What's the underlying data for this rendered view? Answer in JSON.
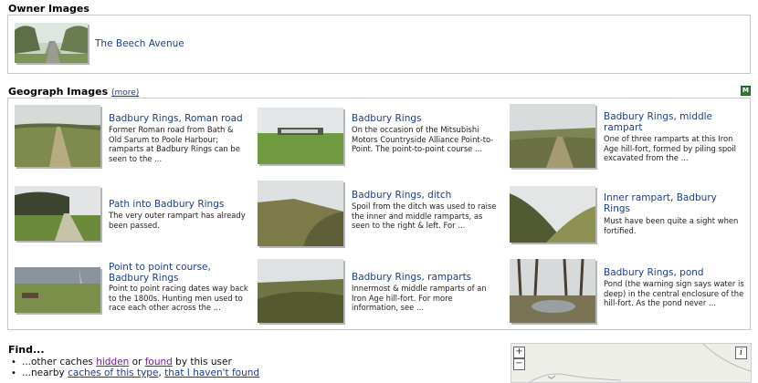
{
  "owner_images": {
    "heading": "Owner Images",
    "items": [
      {
        "title": "The Beech Avenue"
      }
    ]
  },
  "geograph_images": {
    "heading": "Geograph Images",
    "more_label": "(more)",
    "map_icon": "M",
    "items": [
      {
        "title": "Badbury Rings, Roman road",
        "desc": "Former Roman road from Bath & Old Sarum to Poole Harbour; ramparts at Badbury Rings can be seen to the ..."
      },
      {
        "title": "Badbury Rings",
        "desc": "On the occasion of the Mitsubishi Motors Countryside Alliance Point-to-Point. The point-to-point course ..."
      },
      {
        "title": "Badbury Rings, middle rampart",
        "desc": "One of three ramparts at this Iron Age hill-fort, formed by piling spoil excavated from the ..."
      },
      {
        "title": "Path into Badbury Rings",
        "desc": "The very outer rampart has already been passed."
      },
      {
        "title": "Badbury Rings, ditch",
        "desc": "Spoil from the ditch was used to raise the inner and middle ramparts, as seen to the right & left. For ..."
      },
      {
        "title": "Inner rampart, Badbury Rings",
        "desc": "Must have been quite a sight when fortified."
      },
      {
        "title": "Point to point course, Badbury Rings",
        "desc": "Point to point racing dates way back to the 1800s. Hunting men used to race each other across the ..."
      },
      {
        "title": "Badbury Rings, ramparts",
        "desc": "Innermost & middle ramparts of an Iron Age hill-fort. For more information, see ..."
      },
      {
        "title": "Badbury Rings, pond",
        "desc": "Pond (the warning sign says water is deep) in the central enclosure of the hill-fort. As the pond never ..."
      }
    ]
  },
  "find": {
    "heading": "Find...",
    "line1": {
      "prefix": "...other caches",
      "link1": "hidden",
      "mid": "or",
      "link2": "found",
      "suffix": "by this user"
    },
    "line2": {
      "prefix": "...nearby",
      "link1": "caches of this type",
      "sep": ",",
      "link2": "that I haven't found"
    }
  },
  "map": {
    "zoom_in": "+",
    "zoom_out": "−",
    "info": "i"
  }
}
